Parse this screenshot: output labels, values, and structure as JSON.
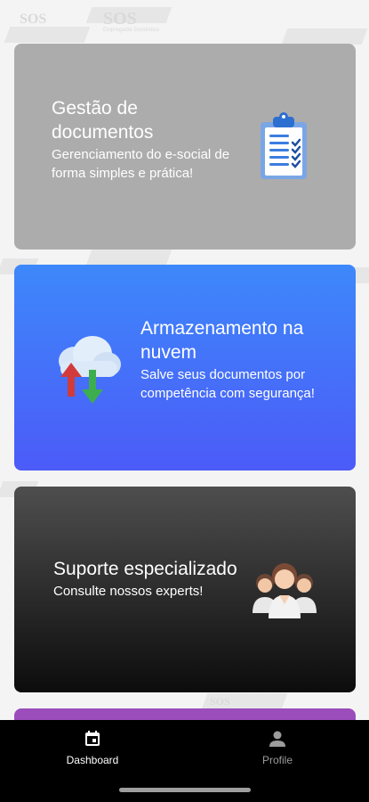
{
  "background": {
    "watermark_text": "SOS",
    "watermark_subtext": "Empregador Doméstico"
  },
  "cards": [
    {
      "title": "Gestão de documentos",
      "description": "Gerenciamento do e-social de forma simples e prática!",
      "icon": "clipboard-checklist-icon",
      "color": "#acacac"
    },
    {
      "title": "Armazenamento na nuvem",
      "description": "Salve seus documentos por competência com segurança!",
      "icon": "cloud-sync-icon",
      "color": "#4c6ff9"
    },
    {
      "title": "Suporte especializado",
      "description": "Consulte nossos experts!",
      "icon": "support-team-icon",
      "color": "#2a2a2a"
    },
    {
      "color": "#9a4dbb"
    }
  ],
  "bottom_nav": {
    "items": [
      {
        "label": "Dashboard",
        "icon": "calendar-icon",
        "active": true
      },
      {
        "label": "Profile",
        "icon": "person-icon",
        "active": false
      }
    ]
  }
}
